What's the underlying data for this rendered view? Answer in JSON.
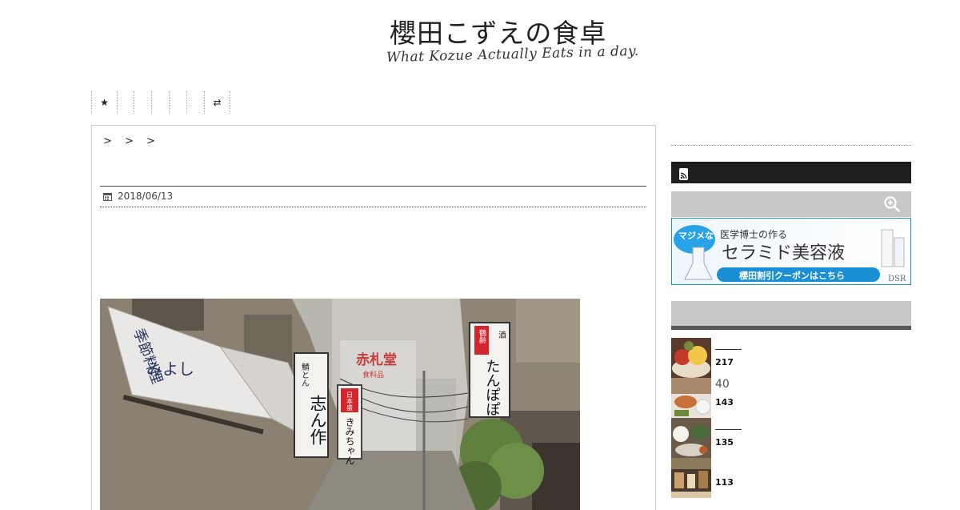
{
  "header": {
    "logo_title": "櫻田こずえの食卓",
    "logo_subtitle": "What Kozue Actually Eats in a day."
  },
  "nav": {
    "items": [
      {
        "label": "★",
        "icon": "star-icon"
      },
      {
        "label": ""
      },
      {
        "label": ""
      },
      {
        "label": ""
      },
      {
        "label": ""
      },
      {
        "label": ""
      },
      {
        "label": "⇄",
        "icon": "shuffle-icon"
      }
    ]
  },
  "post": {
    "breadcrumb": "> > >",
    "date": "2018/06/13",
    "photo_signs": {
      "left_awning_top": "季節料理",
      "left_awning_bottom": "みよし",
      "sign_shinsaku_top": "鯖とん",
      "sign_shinsaku": "志ん作",
      "sign_kimichan_top": "日本盛",
      "sign_kimichan": "きみちゃん",
      "sign_tanpopo_top": "鶴齢",
      "sign_tanpopo": "たんぽぽ",
      "sign_tanpopo_side": "酒",
      "building_sign": "赤札堂",
      "building_sub": "食料品"
    }
  },
  "sidebar": {
    "ad": {
      "badge": "マジメな",
      "line1": "医学博士の作る",
      "line2": "セラミド美容液",
      "cta": "櫻田割引クーポンはこちら",
      "brand": "DSR"
    },
    "ranking": [
      {
        "title": "",
        "count": "217"
      },
      {
        "title": "40",
        "count": "143"
      },
      {
        "title": "",
        "count": "135"
      },
      {
        "title": "",
        "count": "113"
      }
    ]
  },
  "colors": {
    "accent": "#1b8fd6",
    "dark_bar": "#1e1e1e",
    "grey_bar": "#c8c8c8"
  }
}
